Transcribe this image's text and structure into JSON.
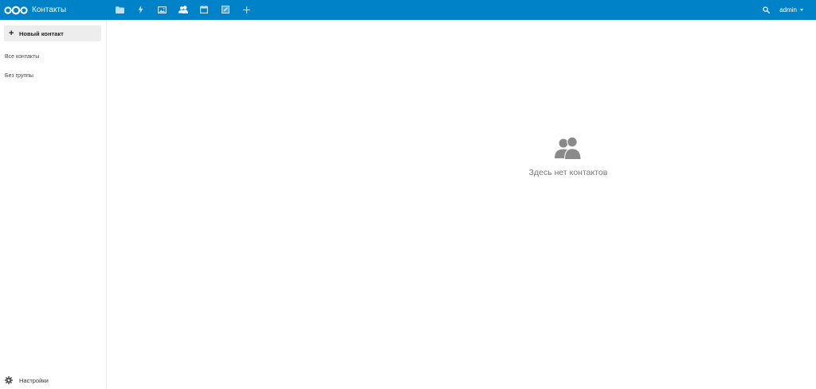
{
  "header": {
    "app_title": "Контакты",
    "accent_color": "#0082c9",
    "nav_items": [
      {
        "name": "files",
        "icon": "folder-icon"
      },
      {
        "name": "activity",
        "icon": "lightning-icon"
      },
      {
        "name": "gallery",
        "icon": "image-icon"
      },
      {
        "name": "contacts",
        "icon": "contacts-icon",
        "active": true
      },
      {
        "name": "calendar",
        "icon": "calendar-icon"
      },
      {
        "name": "notes",
        "icon": "edit-square-icon"
      },
      {
        "name": "more-apps",
        "icon": "plus-icon"
      }
    ],
    "search_icon": "search-icon",
    "user": "admin"
  },
  "sidebar": {
    "new_contact_label": "Новый контакт",
    "items": [
      {
        "label": "Все контакты"
      },
      {
        "label": "Без группы"
      }
    ],
    "settings_label": "Настройки"
  },
  "main": {
    "empty_icon": "contacts-icon",
    "empty_text": "Здесь нет контактов"
  }
}
